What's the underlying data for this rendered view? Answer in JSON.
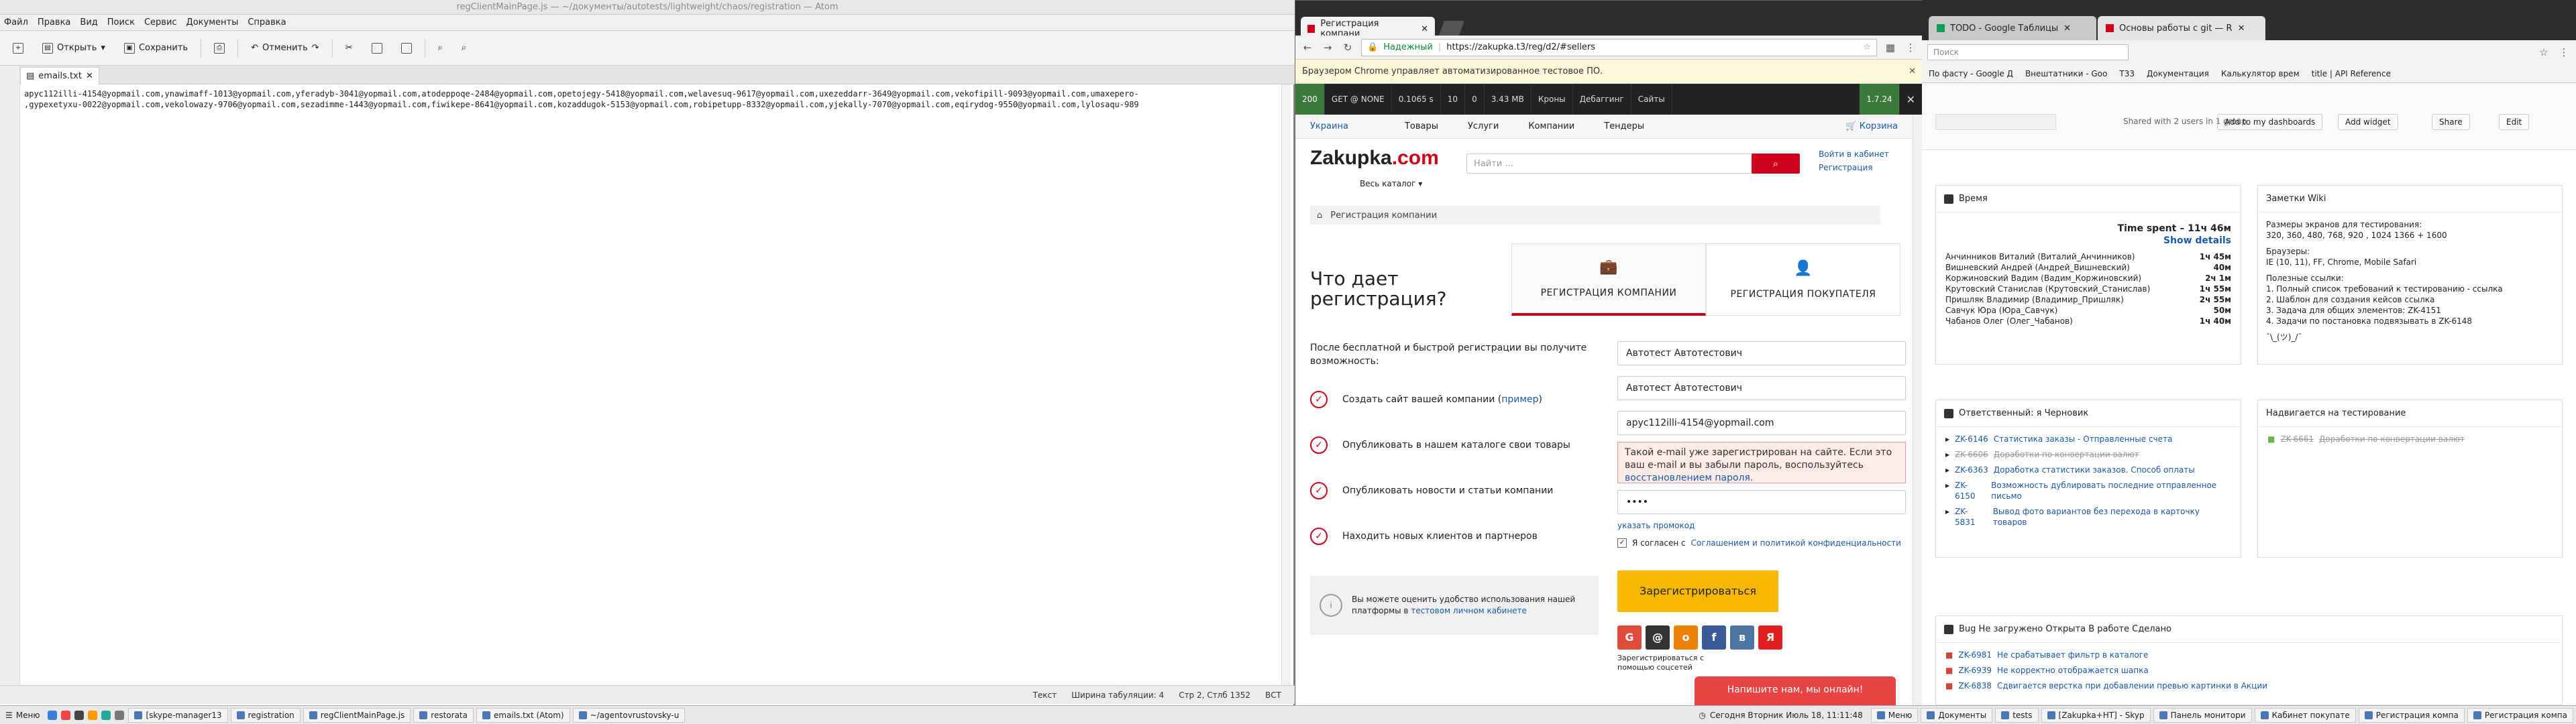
{
  "atom": {
    "title": "regClientMainPage.js — ~/документы/autotests/lightweight/chaos/registration — Atom",
    "menu": [
      "Файл",
      "Правка",
      "Вид",
      "Поиск",
      "Сервис",
      "Документы",
      "Справка"
    ],
    "toolbar": {
      "open": "Открыть",
      "save": "Сохранить",
      "undo": "Отменить"
    },
    "tab": "emails.txt",
    "lines": [
      "apyc112illi-4154@yopmail.com,ynawimaff-1013@yopmail.com,yferadyb-3041@yopmail.com,atodeppoqe-2484@yopmail.com,opetojegy-5418@yopmail.com,welavesuq-9617@yopmail.com,uxezeddarr-3649@yopmail.com,vekofipill-9093@yopmail.com,umaxepero-",
      ",gypexetyxu-0022@yopmail.com,vekolowazy-9706@yopmail.com,sezadimme-1443@yopmail.com,fiwikepe-8641@yopmail.com,kozaddugok-5153@yopmail.com,robipetupp-8332@yopmail.com,yjekally-7070@yopmail.com,eqirydog-9550@yopmail.com,lylosaqu-989"
    ],
    "status": {
      "mode": "Текст",
      "tabs": "Ширина табуляции: 4",
      "pos": "Стр 2, Стлб 1352",
      "ins": "ВСТ"
    }
  },
  "chrome": {
    "tabs": [
      "Регистрация компани"
    ],
    "secure": "Надежный",
    "url": "https://zakupka.t3/reg/d2/#sellers",
    "info": "Браузером Chrome управляет автоматизированное тестовое ПО.",
    "devbar": [
      "200",
      "GET @ NONE",
      "0.1065 s",
      "10",
      "0",
      "3.43 MB",
      "Кроны",
      "Дебаггинг",
      "Сайты",
      "1.7.24"
    ]
  },
  "site": {
    "region": "Украина",
    "nav": [
      "Товары",
      "Услуги",
      "Компании",
      "Тендеры"
    ],
    "cart": "Корзина",
    "logo_a": "Zakupka",
    "logo_b": ".com",
    "catalog": "Весь каталог",
    "search_placeholder": "Найти ...",
    "login": "Войти в кабинет",
    "register": "Регистрация",
    "breadcrumb": "Регистрация компании",
    "why": "Что дает регистрация?",
    "tab_company": "РЕГИСТРАЦИЯ КОМПАНИИ",
    "tab_buyer": "РЕГИСТРАЦИЯ ПОКУПАТЕЛЯ",
    "after": "После бесплатной и быстрой регистрации вы получите возможность:",
    "benefits": [
      "Создать сайт вашей компании (",
      "Опубликовать в нашем каталоге свои товары",
      "Опубликовать новости и статьи компании",
      "Находить новых клиентов и партнеров"
    ],
    "benefit_link": "пример",
    "name1": "Автотест Автотестович",
    "name2": "Автотест Автотестович",
    "email": "apyc112illi-4154@yopmail.com",
    "error": "Такой e-mail уже зарегистрирован на сайте. Если это ваш e-mail и вы забыли пароль, воспользуйтесь",
    "error_link": "восстановлением пароля.",
    "password": "••••",
    "promo": "указать промокод",
    "agree": "Я согласен с",
    "agree_link": "Соглашением и политикой конфиденциальности",
    "submit": "Зарегистрироваться",
    "hint": "Вы можете оценить удобство использования нашей платформы в",
    "hint_link": "тестовом личном кабинете",
    "social_label": "Зарегистрироваться с помощью соцсетей",
    "chat": "Напишите нам, мы онлайн!"
  },
  "sheets": {
    "tabs": [
      "TODO - Google Таблицы",
      "Основы работы с git — R"
    ],
    "search": "Поиск",
    "bookmarks": [
      "По фасту - Google Д",
      "Внештатники - Goo",
      "Т33",
      "Документация",
      "Калькулятор врем",
      "title | API Reference"
    ],
    "shared": "Shared with 2 users in 1 group",
    "btn_dash": "Add to my dashboards",
    "btn_widget": "Add widget",
    "btn_share": "Share",
    "btn_edit": "Edit",
    "time_title": "Время",
    "time_spent": "Time spent – 11ч 46м",
    "show_details": "Show details",
    "time_rows": [
      [
        "Анчинников Виталий (Виталий_Анчинников)",
        "1ч 45м"
      ],
      [
        "Вишневский Андрей (Андрей_Вишневский)",
        "40м"
      ],
      [
        "Коржиновский Вадим (Вадим_Коржиновский)",
        "2ч 1м"
      ],
      [
        "Крутовский Станислав (Крутовский_Станислав)",
        "1ч 55м"
      ],
      [
        "Пришляк Владимир (Владимир_Пришляк)",
        "2ч 55м"
      ],
      [
        "Савчук Юра (Юра_Савчук)",
        "50м"
      ],
      [
        "Чабанов Олег (Олег_Чабанов)",
        "1ч 40м"
      ]
    ],
    "wiki_title": "Заметки Wiki",
    "wiki_lines": [
      "Размеры экранов для тестирования:",
      "320, 360, 480, 768, 920 , 1024 1366 + 1600",
      "",
      "Браузеры:",
      "IE (10, 11), FF, Chrome, Mobile Safari",
      "",
      "Полезные ссылки:",
      "1. Полный список требований к тестированию - ссылка",
      "2. Шаблон для создания кейсов ссылка",
      "3. Задача для общих элементов: ZK-4151",
      "4. Задачи по постановка подвязывать в ZK-6148",
      "",
      "¯\\_(ツ)_/¯"
    ],
    "resp_title": "Ответственный: я Черновик",
    "resp_issues": [
      {
        "key": "ZK-6146",
        "text": "Статистика заказы - Отправленные счета",
        "done": false
      },
      {
        "key": "ZK-6606",
        "text": "Доработки по конвертации валют",
        "done": true
      },
      {
        "key": "ZK-6363",
        "text": "Доработка статистики заказов. Способ оплаты",
        "done": false
      },
      {
        "key": "ZK-6150",
        "text": "Возможность дублировать последние отправленное письмо",
        "done": false
      },
      {
        "key": "ZK-5831",
        "text": "Вывод фото вариантов без перехода в карточку товаров",
        "done": false
      }
    ],
    "test_title": "Надвигается на тестирование",
    "test_issues": [
      {
        "key": "ZK-6661",
        "text": "Доработки по конвертации валют",
        "done": true
      }
    ],
    "bug_title": "Bug Не загружено Открыта В работе Сделано",
    "bug_issues": [
      {
        "key": "ZK-6981",
        "text": "Не срабатывает фильтр в каталоге",
        "done": false
      },
      {
        "key": "ZK-6939",
        "text": "Не корректно отображается шапка",
        "done": false
      },
      {
        "key": "ZK-6838",
        "text": "Сдвигается верстка при добавлении превью картинки в Акции",
        "done": false
      }
    ]
  },
  "taskbar": {
    "start": "Меню",
    "left_items": [
      "[skype-manager13",
      "registration",
      "regClientMainPage.js",
      "restorata",
      "emails.txt (Atom)",
      "~/agentovrustovsky-u"
    ],
    "clock": "Сегодня Вторник Июль 18, 11:11:48",
    "right_items": [
      "Меню",
      "Документы",
      "tests",
      "[Zakupka+HT] - Skyp",
      "Панель монитори",
      "Кабинет покупате",
      "Регистрация компа",
      "Регистрация компа"
    ]
  }
}
